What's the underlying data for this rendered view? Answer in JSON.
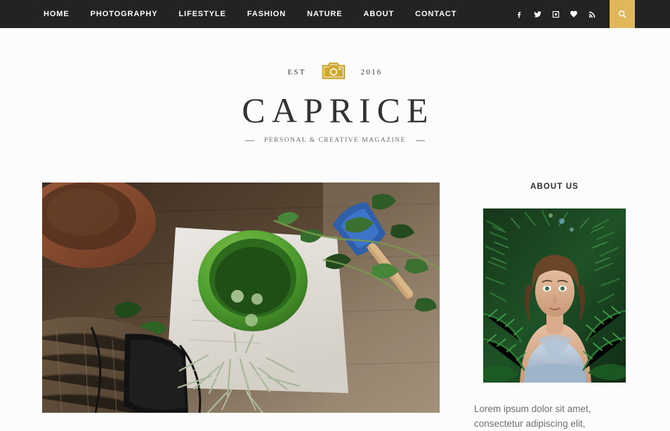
{
  "nav": {
    "items": [
      {
        "label": "HOME"
      },
      {
        "label": "PHOTOGRAPHY"
      },
      {
        "label": "LIFESTYLE"
      },
      {
        "label": "FASHION"
      },
      {
        "label": "NATURE"
      },
      {
        "label": "ABOUT"
      },
      {
        "label": "CONTACT"
      }
    ],
    "social": [
      {
        "name": "facebook-icon"
      },
      {
        "name": "twitter-icon"
      },
      {
        "name": "instagram-icon"
      },
      {
        "name": "bloglovin-heart-icon"
      },
      {
        "name": "rss-icon"
      }
    ],
    "search_label": "Search"
  },
  "brand": {
    "est_label": "EST",
    "year": "2016",
    "title": "CAPRICE",
    "tagline": "PERSONAL & CREATIVE MAGAZINE"
  },
  "sidebar": {
    "about_title": "ABOUT US",
    "about_text": "Lorem ipsum dolor sit amet, consectetur adipiscing elit,"
  },
  "colors": {
    "header_bg": "#232323",
    "accent_gold": "#e0b85b",
    "page_bg": "#fcfcfc",
    "title_text": "#333333",
    "body_text": "#6f6f6f"
  }
}
